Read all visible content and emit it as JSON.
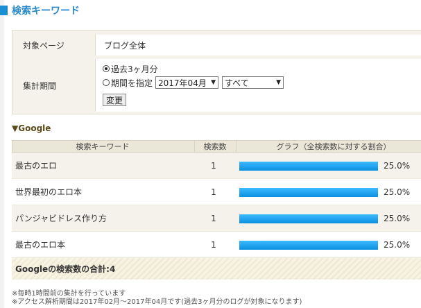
{
  "page_title": "検索キーワード",
  "settings": {
    "target_label": "対象ページ",
    "target_value": "ブログ全体",
    "period_label": "集計期間",
    "radio_recent": "過去3ヶ月分",
    "radio_specify": "期間を指定",
    "month_select": "2017年04月",
    "scope_select": "すべて",
    "change_button": "変更"
  },
  "google": {
    "section_title": "▼Google",
    "headers": {
      "keyword": "検索キーワード",
      "count": "検索数",
      "graph": "グラフ（全検索数に対する割合）"
    },
    "rows": [
      {
        "keyword": "最古のエロ",
        "count": "1",
        "percent": "25.0%",
        "ratio": 0.25
      },
      {
        "keyword": "世界最初のエロ本",
        "count": "1",
        "percent": "25.0%",
        "ratio": 0.25
      },
      {
        "keyword": "パンジャビドレス作り方",
        "count": "1",
        "percent": "25.0%",
        "ratio": 0.25
      },
      {
        "keyword": "最古のエロ本",
        "count": "1",
        "percent": "25.0%",
        "ratio": 0.25
      }
    ],
    "total": "Googleの検索数の合計:4"
  },
  "notes": {
    "line1": "※毎時1時間前の集計を行っています",
    "line2": "※アクセス解析期間は2017年02月～2017年04月です(過去3ヶ月分のログが対象になります)"
  },
  "colors": {
    "accent": "#2a89c8",
    "bar": "#0a90e0"
  }
}
